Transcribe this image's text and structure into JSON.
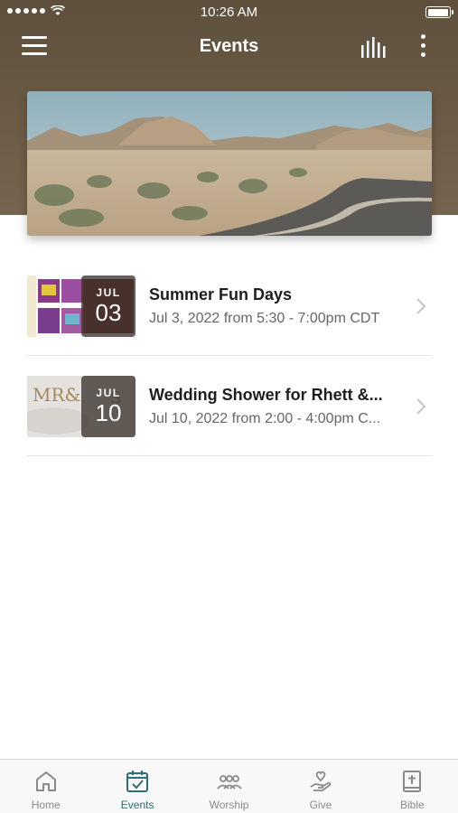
{
  "status_bar": {
    "time": "10:26 AM"
  },
  "nav": {
    "title": "Events"
  },
  "events": [
    {
      "month": "JUL",
      "day": "03",
      "title": "Summer Fun Days",
      "subtitle": "Jul 3, 2022 from 5:30 - 7:00pm CDT"
    },
    {
      "month": "JUL",
      "day": "10",
      "title": "Wedding Shower for Rhett &...",
      "subtitle": "Jul 10, 2022 from 2:00 - 4:00pm C..."
    }
  ],
  "tabs": [
    {
      "label": "Home",
      "icon": "home-icon"
    },
    {
      "label": "Events",
      "icon": "calendar-icon"
    },
    {
      "label": "Worship",
      "icon": "people-icon"
    },
    {
      "label": "Give",
      "icon": "give-hand-icon"
    },
    {
      "label": "Bible",
      "icon": "bible-icon"
    }
  ],
  "colors": {
    "header": "#6b5b46",
    "accent": "#2c6e74",
    "inactive_tab": "#8a8a8a"
  }
}
